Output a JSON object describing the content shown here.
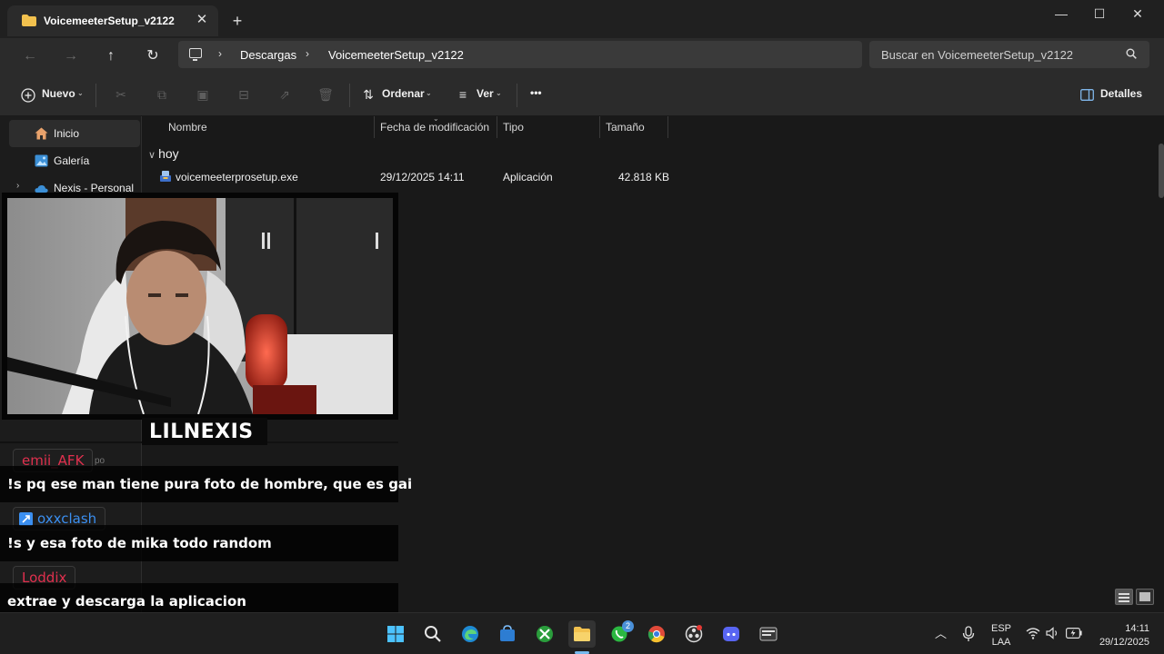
{
  "window": {
    "tab_title": "VoicemeeterSetup_v2122",
    "tab_close": "✕",
    "new_tab": "+",
    "minimize": "—",
    "maximize": "☐",
    "close": "✕"
  },
  "nav": {
    "back": "←",
    "forward": "→",
    "up": "↑",
    "refresh": "↻",
    "breadcrumb": [
      "Descargas",
      "VoicemeeterSetup_v2122"
    ],
    "search_placeholder": "Buscar en VoicemeeterSetup_v2122"
  },
  "toolbar": {
    "new_label": "Nuevo",
    "sort_label": "Ordenar",
    "view_label": "Ver",
    "more_label": "•••",
    "details_label": "Detalles"
  },
  "sidebar": {
    "items": [
      {
        "label": "Inicio",
        "icon": "home-icon"
      },
      {
        "label": "Galería",
        "icon": "gallery-icon"
      },
      {
        "label": "Nexis - Personal",
        "icon": "onedrive-cloud-icon"
      }
    ]
  },
  "file_list": {
    "columns": [
      "Nombre",
      "Fecha de modificación",
      "Tipo",
      "Tamaño"
    ],
    "group_label": "hoy",
    "rows": [
      {
        "name": "voicemeeterprosetup.exe",
        "modified": "29/12/2025 14:11",
        "type": "Aplicación",
        "size": "42.818 KB"
      }
    ]
  },
  "stream_overlay": {
    "streamer_name": "LILNEXIS",
    "chat": [
      {
        "user": "emii_AFK",
        "user_color": "#e0304e",
        "message": "!s pq ese man tiene pura foto de hombre, que es gai"
      },
      {
        "user": "oxxclash",
        "user_color": "#3b8ff0",
        "message": "!s y esa foto de mika todo random"
      },
      {
        "user": "Loddix",
        "user_color": "#e0304e",
        "message": "extrae y descarga la aplicacion"
      }
    ]
  },
  "taskbar": {
    "icons": [
      "windows-start-icon",
      "search-icon",
      "edge-icon",
      "store-icon",
      "xbox-icon",
      "file-explorer-icon",
      "whatsapp-icon",
      "chrome-icon",
      "obs-icon",
      "discord-icon",
      "terminal-icon"
    ],
    "whatsapp_badge": "2",
    "lang_top": "ESP",
    "lang_bottom": "LAA",
    "time": "14:11",
    "date": "29/12/2025"
  },
  "colors": {
    "accent": "#76b9ed",
    "folder": "#f2c14e",
    "background": "#191919"
  }
}
